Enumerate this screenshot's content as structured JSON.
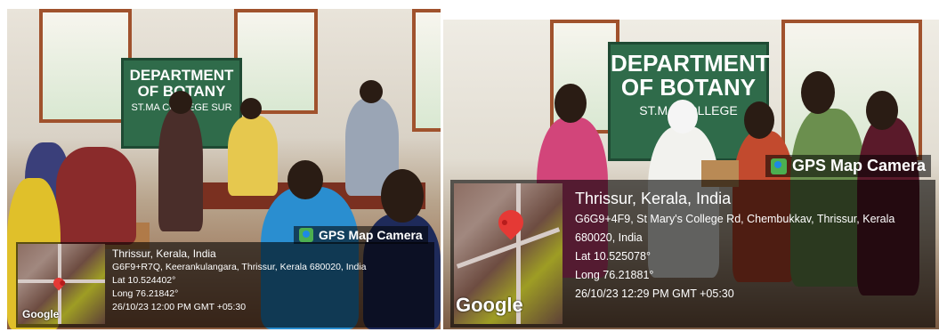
{
  "left_photo": {
    "board": {
      "line1": "DEPARTMENT",
      "line2": "OF BOTANY",
      "line3": "ST.MA   COLLEGE\n           SUR"
    },
    "tag": "GPS Map Camera",
    "google": "Google",
    "place": "Thrissur, Kerala, India",
    "address": "G6F9+R7Q, Keerankulangara, Thrissur, Kerala 680020, India",
    "lat": "Lat 10.524402°",
    "long": "Long 76.21842°",
    "datetime": "26/10/23 12:00 PM GMT +05:30"
  },
  "right_photo": {
    "board": {
      "line1": "DEPARTMENT",
      "line2": "OF BOTANY",
      "line3": "ST.MA   COLLEGE"
    },
    "tag": "GPS Map Camera",
    "google": "Google",
    "place": "Thrissur, Kerala, India",
    "address_line1": "G6G9+4F9, St Mary's College Rd, Chembukkav, Thrissur, Kerala",
    "address_line2": "680020, India",
    "lat": "Lat 10.525078°",
    "long": "Long 76.21881°",
    "datetime": "26/10/23 12:29 PM GMT +05:30"
  }
}
